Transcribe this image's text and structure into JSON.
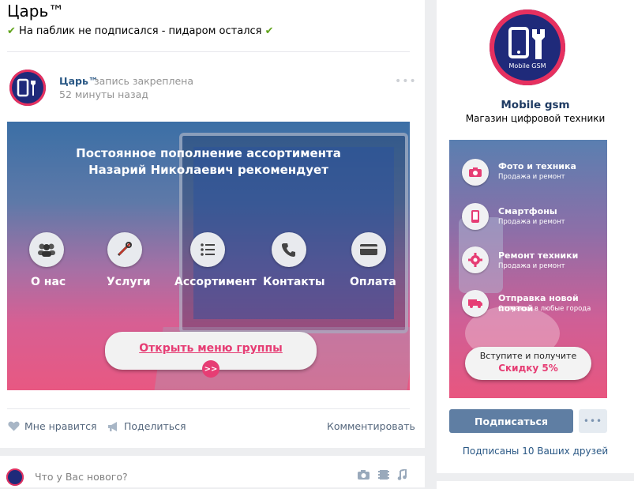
{
  "group": {
    "name": "Царь™",
    "status": "На паблик не подписался - пидаром остался",
    "status_icon": "✔"
  },
  "post": {
    "author": "Царь™",
    "pinned_label": "запись закреплена",
    "time": "52 минуты назад",
    "more": "•••",
    "avatar_caption": "Mobile GSM",
    "banner": {
      "line1": "Постоянное пополнение ассортимента",
      "line2": "Назарий Николаевич рекомендует",
      "menu": [
        {
          "label": "О нас",
          "icon": "people-icon"
        },
        {
          "label": "Услуги",
          "icon": "tools-icon"
        },
        {
          "label": "Ассортимент",
          "icon": "list-icon"
        },
        {
          "label": "Контакты",
          "icon": "phone-icon"
        },
        {
          "label": "Оплата",
          "icon": "card-icon"
        }
      ],
      "open_button": "Открыть меню группы",
      "open_arrow": ">>"
    },
    "actions": {
      "like": "Мне нравится",
      "share": "Поделиться",
      "comment": "Комментировать"
    }
  },
  "composer": {
    "placeholder": "Что у Вас нового?"
  },
  "sidebar": {
    "avatar_caption": "Mobile GSM",
    "name": "Mobile gsm",
    "description": "Магазин цифровой техники",
    "ad": {
      "items": [
        {
          "title": "Фото и техника",
          "subtitle": "Продажа и ремонт",
          "icon": "camera-icon"
        },
        {
          "title": "Смартфоны",
          "subtitle": "Продажа и ремонт",
          "icon": "smartphone-icon"
        },
        {
          "title": "Ремонт техники",
          "subtitle": "Продажа и ремонт",
          "icon": "gear-icon"
        },
        {
          "title": "Отправка новой почтой",
          "subtitle": "Отправка в любые города",
          "icon": "truck-icon"
        }
      ],
      "promo_line1": "Вступите и получите",
      "promo_line2": "Скидку 5%"
    },
    "subscribe": "Подписаться",
    "more": "•••",
    "friends": "Подписаны 10 Ваших друзей"
  },
  "colors": {
    "accent": "#e63d74",
    "link": "#2a5885",
    "button": "#5f7ea3",
    "check": "#5fa319"
  }
}
